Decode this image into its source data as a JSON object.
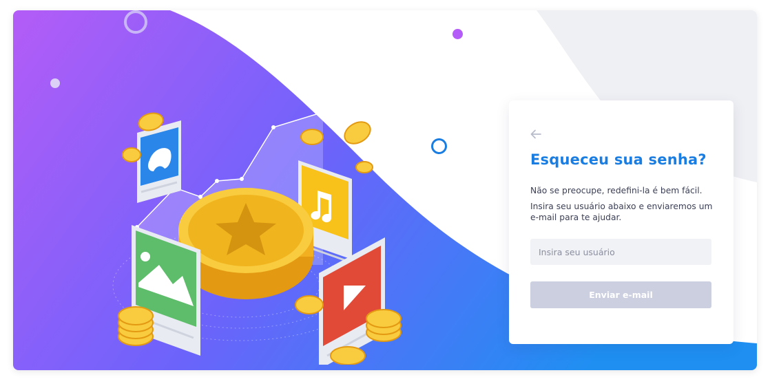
{
  "card": {
    "title": "Esqueceu sua senha?",
    "line1": "Não se preocupe, redefini-la é bem fácil.",
    "line2": "Insira seu usuário abaixo e enviaremos um e-mail para te ajudar.",
    "username_placeholder": "Insira seu usuário",
    "username_value": "",
    "submit_label": "Enviar e-mail",
    "back_icon": "arrow-left-icon"
  },
  "colors": {
    "gradient_start": "#b45cf7",
    "gradient_mid": "#6c63fb",
    "gradient_end": "#1f8ff2",
    "title_blue": "#1a7de2",
    "button_disabled": "#cbcfe0",
    "input_bg": "#f1f2f6"
  },
  "illustration": {
    "icons": [
      "game-controller-icon",
      "music-note-icon",
      "image-icon",
      "play-icon",
      "star-coin-icon",
      "coin-icon",
      "growth-chart-icon"
    ]
  }
}
